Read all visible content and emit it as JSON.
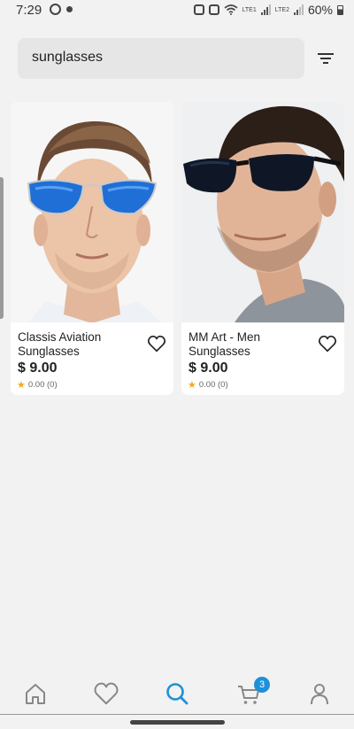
{
  "status_bar": {
    "time": "7:29",
    "lte1": "LTE1",
    "lte2": "LTE2",
    "battery": "60%"
  },
  "search": {
    "query": "sunglasses"
  },
  "products": [
    {
      "title": "Classis Aviation Sunglasses",
      "price": "$ 9.00",
      "rating": "0.00 (0)"
    },
    {
      "title": "MM Art - Men Sunglasses",
      "price": "$ 9.00",
      "rating": "0.00 (0)"
    }
  ],
  "bottom_nav": {
    "items": [
      "home-icon",
      "heart-icon",
      "search-icon",
      "cart-icon",
      "profile-icon"
    ],
    "active": "search-icon",
    "cart_badge": "3"
  },
  "colors": {
    "accent": "#1e90d8",
    "star": "#f5a623",
    "background": "#f2f2f2"
  }
}
